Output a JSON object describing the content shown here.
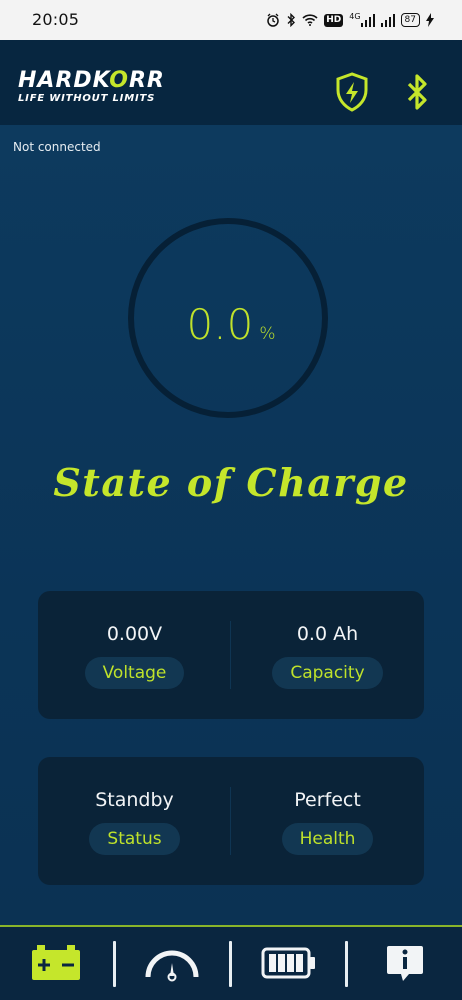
{
  "status_bar": {
    "time": "20:05",
    "hd_label": "HD",
    "signal_label": "4G",
    "battery_label": "87"
  },
  "header": {
    "brand_part1": "HARDK",
    "brand_part2": "O",
    "brand_part3": "RR",
    "tagline": "LIFE WITHOUT LIMITS",
    "icons": [
      "shield-charge-icon",
      "bluetooth-icon"
    ]
  },
  "connection_status": "Not connected",
  "gauge": {
    "value": "0.0",
    "unit": "%",
    "title": "State of Charge"
  },
  "cards": {
    "voltage": {
      "value": "0.00V",
      "label": "Voltage"
    },
    "capacity": {
      "value": "0.0 Ah",
      "label": "Capacity"
    },
    "status": {
      "value": "Standby",
      "label": "Status"
    },
    "health": {
      "value": "Perfect",
      "label": "Health"
    }
  },
  "bottom_nav": {
    "items": [
      "battery-icon",
      "speedometer-icon",
      "battery-level-icon",
      "info-icon"
    ]
  },
  "colors": {
    "accent": "#c5e62b",
    "background": "#0b3457",
    "card": "#0a2338",
    "header": "#072640"
  }
}
